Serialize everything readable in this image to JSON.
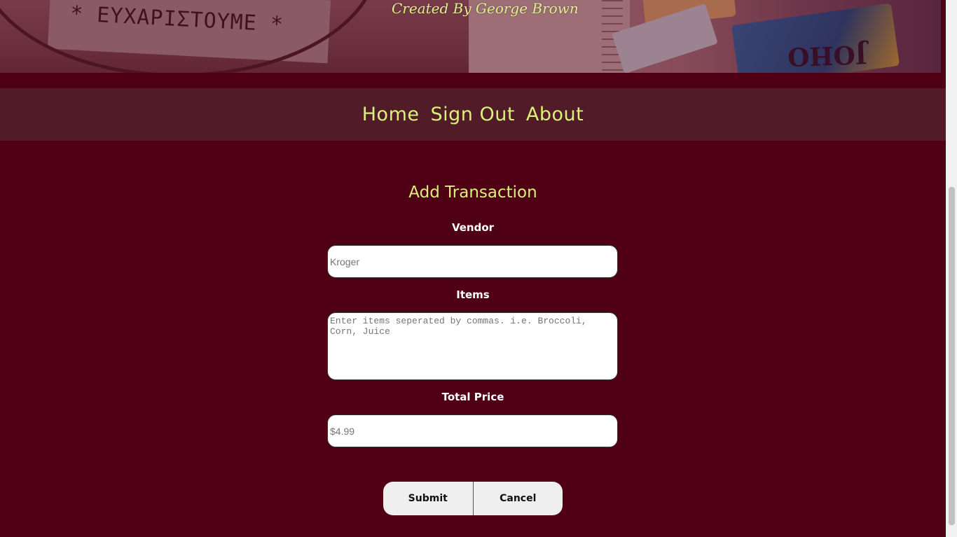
{
  "banner": {
    "credit": "Created By George Brown",
    "photo_text_left": "* ΕΥΧΑΡΙΣΤΟΥΜΕ *",
    "photo_text_right": "JOHO"
  },
  "nav": {
    "items": [
      {
        "label": "Home"
      },
      {
        "label": "Sign Out"
      },
      {
        "label": "About"
      }
    ]
  },
  "form": {
    "title": "Add Transaction",
    "vendor": {
      "label": "Vendor",
      "placeholder": "Kroger",
      "value": ""
    },
    "items": {
      "label": "Items",
      "placeholder": "Enter items seperated by commas. i.e. Broccoli, Corn, Juice",
      "value": ""
    },
    "price": {
      "label": "Total Price",
      "placeholder": "$4.99",
      "value": ""
    },
    "submit_label": "Submit",
    "cancel_label": "Cancel"
  },
  "colors": {
    "background": "#4f0014",
    "nav_background": "#511c27",
    "accent_text": "#d9f07c"
  }
}
